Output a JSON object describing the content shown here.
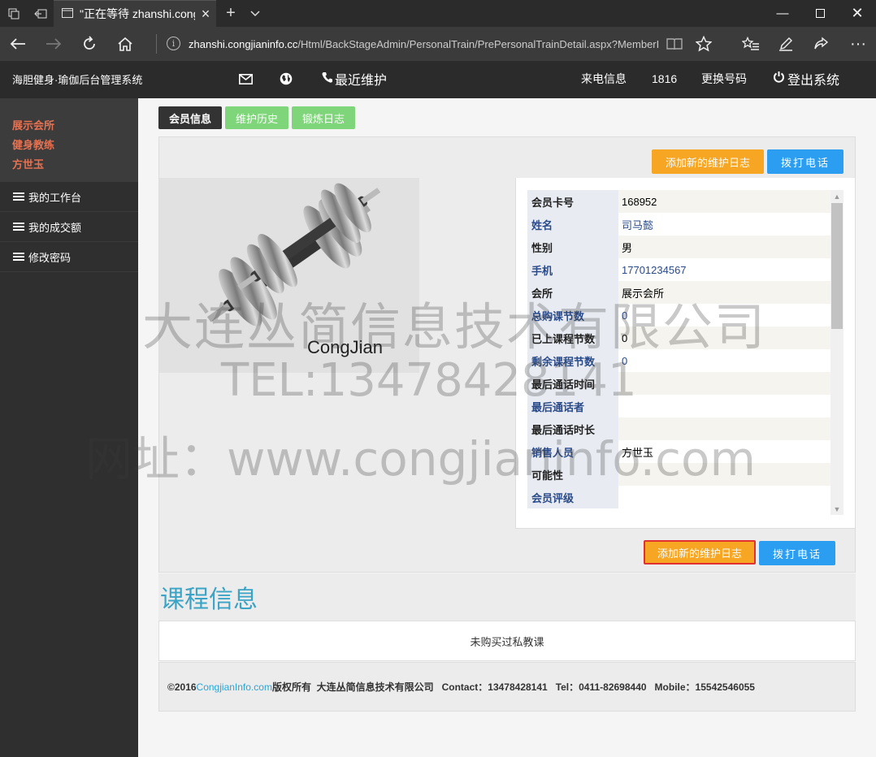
{
  "browser": {
    "tab_title": "\"正在等待 zhanshi.cong",
    "url_host": "zhanshi.congjianinfo.cc",
    "url_path": "/Html/BackStageAdmin/PersonalTrain/PrePersonalTrainDetail.aspx?MemberInde"
  },
  "header": {
    "brand": "海胆健身·瑜伽后台管理系统",
    "recent": "最近维护",
    "caller_label": "来电信息",
    "caller_number": "1816",
    "change_number": "更换号码",
    "logout": "登出系统"
  },
  "sidebar": {
    "profile": [
      "展示会所",
      "健身教练",
      "方世玉"
    ],
    "items": [
      {
        "label": "我的工作台"
      },
      {
        "label": "我的成交额"
      },
      {
        "label": "修改密码"
      }
    ]
  },
  "tabs": [
    "会员信息",
    "维护历史",
    "锻炼日志"
  ],
  "actions": {
    "add_log": "添加新的维护日志",
    "call": "拨打电话"
  },
  "photo_caption": "CongJian",
  "member": [
    {
      "label": "会员卡号",
      "value": "168952"
    },
    {
      "label": "姓名",
      "value": "司马懿"
    },
    {
      "label": "性别",
      "value": "男"
    },
    {
      "label": "手机",
      "value": "17701234567"
    },
    {
      "label": "会所",
      "value": "展示会所"
    },
    {
      "label": "总购课节数",
      "value": "0"
    },
    {
      "label": "已上课程节数",
      "value": "0"
    },
    {
      "label": "剩余课程节数",
      "value": "0"
    },
    {
      "label": "最后通话时间",
      "value": ""
    },
    {
      "label": "最后通话者",
      "value": ""
    },
    {
      "label": "最后通话时长",
      "value": ""
    },
    {
      "label": "销售人员",
      "value": "方世玉"
    },
    {
      "label": "可能性",
      "value": ""
    },
    {
      "label": "会员评级",
      "value": ""
    }
  ],
  "course": {
    "title": "课程信息",
    "empty": "未购买过私教课"
  },
  "footer": {
    "copy_prefix": "©2016 ",
    "link": "CongjianInfo.com",
    "rest": "版权所有  大连丛简信息技术有限公司   Contact：13478428141   Tel：0411-82698440   Mobile：15542546055"
  },
  "watermark": {
    "line1": "大连丛简信息技术有限公司",
    "line2": "TEL:13478428141",
    "line3": "网址：www.congjianinfo.com"
  }
}
